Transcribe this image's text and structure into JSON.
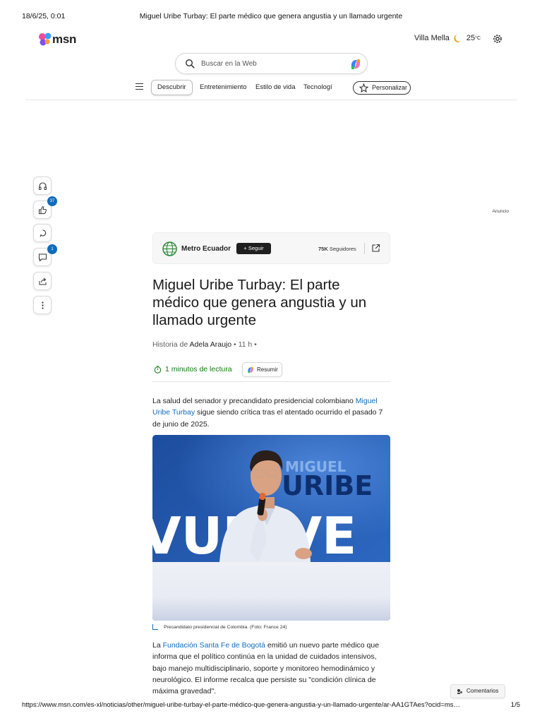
{
  "print_header": {
    "date": "18/6/25, 0:01",
    "title": "Miguel Uribe Turbay: El parte médico que genera angustia y un llamado urgente"
  },
  "print_footer": {
    "url": "https://www.msn.com/es-xl/noticias/other/miguel-uribe-turbay-el-parte-médico-que-genera-angustia-y-un-llamado-urgente/ar-AA1GTAes?ocid=ms…",
    "page": "1/5"
  },
  "header": {
    "logo_text": "msn",
    "weather": {
      "city": "Villa Mella",
      "temp": "25",
      "unit": "°C",
      "icon": "moon-icon"
    },
    "settings_icon": "gear-icon"
  },
  "search": {
    "placeholder": "Buscar en la Web"
  },
  "nav": {
    "tabs": [
      {
        "label": "Descubrir",
        "active": true
      },
      {
        "label": "Entretenimiento"
      },
      {
        "label": "Estilo de vida"
      },
      {
        "label": "Tecnologí"
      }
    ],
    "personalize": "Personalizar"
  },
  "ad_label": "Anuncio",
  "rail": {
    "like_count": "37",
    "comment_count": "1"
  },
  "publisher": {
    "name": "Metro Ecuador",
    "follow": "+ Seguir",
    "followers_count": "75K",
    "followers_label": "Seguidores"
  },
  "article": {
    "title": "Miguel Uribe Turbay: El parte médico que genera angustia y un llamado urgente",
    "byline_prefix": "Historia de",
    "author": "Adela Araujo",
    "time": "• 11 h •",
    "read_time": "1 minutos de lectura",
    "summarize": "Resumir",
    "p1_a": "La salud del senador y precandidato presidencial colombiano ",
    "p1_link": "Miguel Uribe Turbay",
    "p1_b": " sigue siendo crítica tras el atentado ocurrido el pasado 7 de junio de 2025.",
    "image_text_1": "MIGUEL",
    "image_text_2": "URIBE",
    "image_text_3": "VUELVE",
    "caption": "Precandidato presidencial de Colombia. (Foto: France 24)",
    "p2_a": "La ",
    "p2_link": "Fundación Santa Fe de Bogotá",
    "p2_b": " emitió un nuevo parte médico que informa que el político continúa en la unidad de cuidados intensivos, bajo manejo multidisciplinario, soporte y monitoreo hemodinámico y neurológico. El informe recalca que persiste su \"condición clínica de máxima gravedad\"."
  },
  "comments_button": "Comentarios"
}
